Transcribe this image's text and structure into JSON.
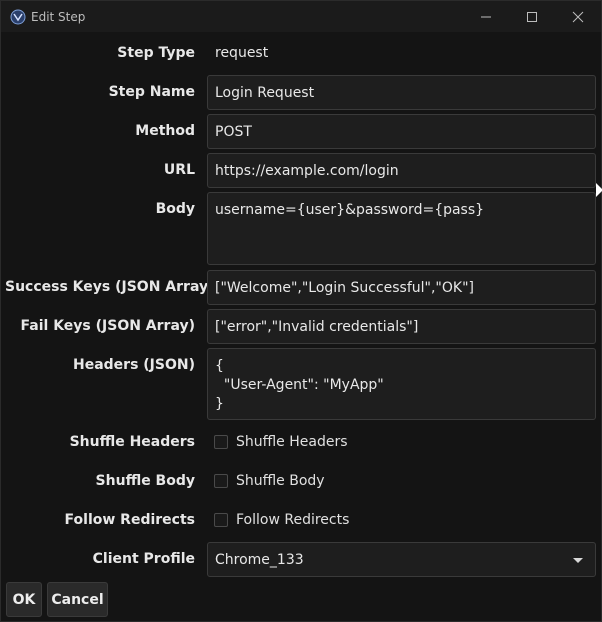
{
  "window": {
    "title": "Edit Step",
    "controls": {
      "minimize": "minimize-icon",
      "maximize": "maximize-icon",
      "close": "close-icon"
    }
  },
  "form": {
    "step_type": {
      "label": "Step Type",
      "value": "request"
    },
    "step_name": {
      "label": "Step Name",
      "value": "Login Request"
    },
    "method": {
      "label": "Method",
      "value": "POST"
    },
    "url": {
      "label": "URL",
      "value": "https://example.com/login"
    },
    "body": {
      "label": "Body",
      "value": "username={user}&password={pass}"
    },
    "success_keys": {
      "label": "Success Keys (JSON Array)",
      "value": "[\"Welcome\",\"Login Successful\",\"OK\"]"
    },
    "fail_keys": {
      "label": "Fail Keys (JSON Array)",
      "value": "[\"error\",\"Invalid credentials\"]"
    },
    "headers": {
      "label": "Headers (JSON)",
      "value": "{\n  \"User-Agent\": \"MyApp\"\n}"
    },
    "shuffle_headers": {
      "label": "Shuffle Headers",
      "checkbox_label": "Shuffle Headers",
      "checked": false
    },
    "shuffle_body": {
      "label": "Shuffle Body",
      "checkbox_label": "Shuffle Body",
      "checked": false
    },
    "follow_redirects": {
      "label": "Follow Redirects",
      "checkbox_label": "Follow Redirects",
      "checked": false
    },
    "client_profile": {
      "label": "Client Profile",
      "value": "Chrome_133"
    }
  },
  "buttons": {
    "ok": "OK",
    "cancel": "Cancel"
  },
  "colors": {
    "background": "#141414",
    "field_bg": "#1e1e1e",
    "border": "#3a3a3a",
    "text": "#e8e8e8"
  }
}
